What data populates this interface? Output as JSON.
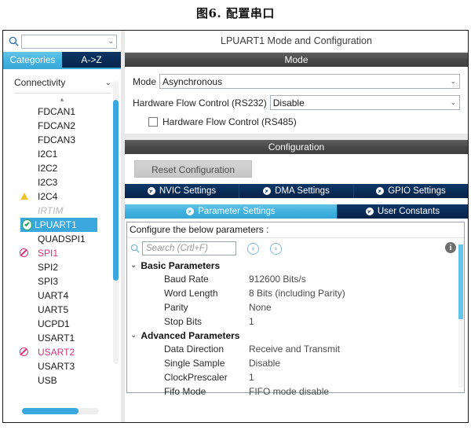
{
  "figure": {
    "caption": "图6. 配置串口"
  },
  "left_panel": {
    "search": {
      "placeholder": "",
      "value": "",
      "icon": "search-icon",
      "chevron": "⌄"
    },
    "tabs": [
      {
        "label": "Categories",
        "active": true
      },
      {
        "label": "A->Z",
        "active": false
      }
    ],
    "group": {
      "label": "Connectivity",
      "chevron": "⌄",
      "collapse_arrow": "⬍"
    },
    "items": [
      {
        "label": "FDCAN1",
        "state": "normal"
      },
      {
        "label": "FDCAN2",
        "state": "normal"
      },
      {
        "label": "FDCAN3",
        "state": "normal"
      },
      {
        "label": "I2C1",
        "state": "normal"
      },
      {
        "label": "I2C2",
        "state": "normal"
      },
      {
        "label": "I2C3",
        "state": "normal"
      },
      {
        "label": "I2C4",
        "state": "warning"
      },
      {
        "label": "IRTIM",
        "state": "disabled"
      },
      {
        "label": "LPUART1",
        "state": "selected"
      },
      {
        "label": "QUADSPI1",
        "state": "normal"
      },
      {
        "label": "SPI1",
        "state": "error"
      },
      {
        "label": "SPI2",
        "state": "normal"
      },
      {
        "label": "SPI3",
        "state": "normal"
      },
      {
        "label": "UART4",
        "state": "normal"
      },
      {
        "label": "UART5",
        "state": "normal"
      },
      {
        "label": "UCPD1",
        "state": "normal"
      },
      {
        "label": "USART1",
        "state": "normal"
      },
      {
        "label": "USART2",
        "state": "error"
      },
      {
        "label": "USART3",
        "state": "normal"
      },
      {
        "label": "USB",
        "state": "normal"
      }
    ]
  },
  "right_panel": {
    "title": "LPUART1 Mode and Configuration",
    "mode_section": {
      "header": "Mode",
      "mode": {
        "label": "Mode",
        "value": "Asynchronous",
        "chevron": "⌄"
      },
      "hw_flow_232": {
        "label": "Hardware Flow Control (RS232)",
        "value": "Disable",
        "chevron": "⌄"
      },
      "hw_flow_485": {
        "label": "Hardware Flow Control (RS485)",
        "checked": false
      }
    },
    "config_section": {
      "header": "Configuration",
      "reset_button": "Reset Configuration",
      "tabs_row1": [
        {
          "label": "NVIC Settings",
          "active": false
        },
        {
          "label": "DMA Settings",
          "active": false
        },
        {
          "label": "GPIO Settings",
          "active": false
        }
      ],
      "tabs_row2": [
        {
          "label": "Parameter Settings",
          "active": true
        },
        {
          "label": "User Constants",
          "active": false
        }
      ],
      "configure_hint": "Configure the below parameters :",
      "search": {
        "placeholder": "Search (Crtl+F)",
        "value": "",
        "icon": "search-icon"
      },
      "nav_prev": "‹",
      "nav_next": "›",
      "info_icon": "i",
      "groups": [
        {
          "label": "Basic Parameters",
          "chevron": "⌄",
          "rows": [
            {
              "name": "Baud Rate",
              "value": "912600 Bits/s"
            },
            {
              "name": "Word Length",
              "value": "8 Bits (including Parity)"
            },
            {
              "name": "Parity",
              "value": "None"
            },
            {
              "name": "Stop Bits",
              "value": "1"
            }
          ]
        },
        {
          "label": "Advanced Parameters",
          "chevron": "⌄",
          "rows": [
            {
              "name": "Data Direction",
              "value": "Receive and Transmit"
            },
            {
              "name": "Single Sample",
              "value": "Disable"
            },
            {
              "name": "ClockPrescaler",
              "value": "1"
            },
            {
              "name": "Fifo Mode",
              "value": "FIFO mode disable"
            }
          ]
        }
      ]
    }
  },
  "colors": {
    "accent_blue": "#3aa8de",
    "tab_navy": "#0d3767",
    "warning_yellow": "#f2c230",
    "error_pink": "#d6337f",
    "ok_green": "#17a05a",
    "section_gray": "#4a4a4a"
  }
}
